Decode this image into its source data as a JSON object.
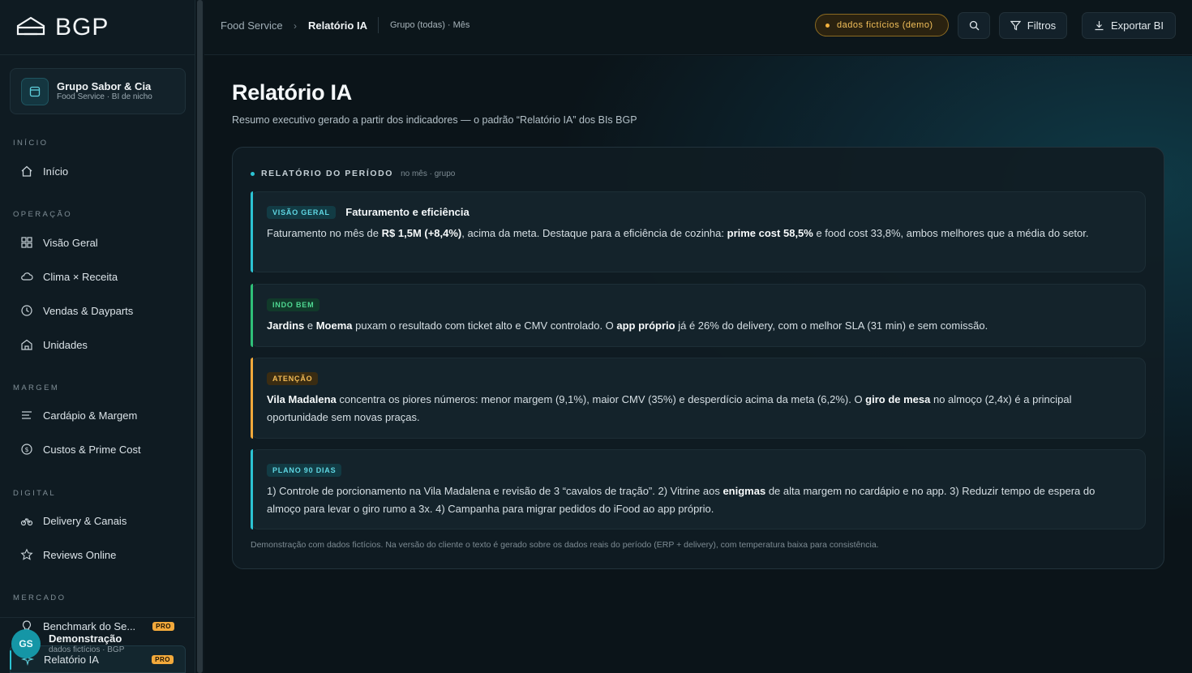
{
  "brand": {
    "logo_text": "BGP"
  },
  "org": {
    "name": "Grupo Sabor & Cia",
    "subtitle": "Food Service · BI de nicho"
  },
  "sidebar": {
    "sections": [
      {
        "label": "INÍCIO",
        "items": [
          {
            "label": "Início",
            "icon": "home-icon"
          }
        ]
      },
      {
        "label": "OPERAÇÃO",
        "items": [
          {
            "label": "Visão Geral",
            "icon": "grid-icon"
          },
          {
            "label": "Clima × Receita",
            "icon": "cloud-icon"
          },
          {
            "label": "Vendas & Dayparts",
            "icon": "clock-icon"
          },
          {
            "label": "Unidades",
            "icon": "store-icon"
          }
        ]
      },
      {
        "label": "MARGEM",
        "items": [
          {
            "label": "Cardápio & Margem",
            "icon": "menu-list-icon"
          },
          {
            "label": "Custos & Prime Cost",
            "icon": "coin-icon"
          }
        ]
      },
      {
        "label": "DIGITAL",
        "items": [
          {
            "label": "Delivery & Canais",
            "icon": "bike-icon"
          },
          {
            "label": "Reviews Online",
            "icon": "star-icon"
          }
        ]
      },
      {
        "label": "MERCADO",
        "items": [
          {
            "label": "Benchmark do Se...",
            "icon": "bulb-icon",
            "badge": "PRO"
          },
          {
            "label": "Relatório IA",
            "icon": "sparkle-icon",
            "badge": "PRO",
            "active": true
          }
        ]
      }
    ]
  },
  "user": {
    "initials": "GS",
    "name": "Demonstração",
    "subtitle": "dados fictícios · BGP"
  },
  "topbar": {
    "breadcrumb": [
      "Food Service",
      "Relatório IA"
    ],
    "separator": "›",
    "context": "Grupo (todas) · Mês",
    "demo_badge": "dados fictícios (demo)",
    "filters_label": "Filtros",
    "export_label": "Exportar BI"
  },
  "page": {
    "title": "Relatório IA",
    "subtitle": "Resumo executivo gerado a partir dos indicadores — o padrão “Relatório IA” dos BIs BGP"
  },
  "report": {
    "title": "RELATÓRIO DO PERÍODO",
    "context": "no mês · grupo",
    "blocks": [
      {
        "tag": "VISÃO GERAL",
        "title": "Faturamento e eficiência",
        "color": "#2cc3d3",
        "parts": [
          [
            "Faturamento no mês de ",
            false
          ],
          [
            "R$ 1,5M (+8,4%)",
            true
          ],
          [
            ", acima da meta. Destaque para a eficiência de cozinha: ",
            false
          ],
          [
            "prime cost 58,5%",
            true
          ],
          [
            " e food cost 33,8%, ambos melhores que a média do setor.",
            false
          ]
        ]
      },
      {
        "tag": "INDO BEM",
        "title": "",
        "color": "#2fbf78",
        "parts": [
          [
            "Jardins",
            true
          ],
          [
            " e ",
            false
          ],
          [
            "Moema",
            true
          ],
          [
            " puxam o resultado com ticket alto e CMV controlado. O ",
            false
          ],
          [
            "app próprio",
            true
          ],
          [
            " já é 26% do delivery, com o melhor SLA (31 min) e sem comissão.",
            false
          ]
        ]
      },
      {
        "tag": "ATENÇÃO",
        "title": "",
        "color": "#f2a93b",
        "parts": [
          [
            "Vila Madalena",
            true
          ],
          [
            " concentra os piores números: menor margem (9,1%), maior CMV (35%) e desperdício acima da meta (6,2%). O ",
            false
          ],
          [
            "giro de mesa",
            true
          ],
          [
            " no almoço (2,4x) é a principal oportunidade sem novas praças.",
            false
          ]
        ]
      },
      {
        "tag": "PLANO 90 DIAS",
        "title": "",
        "color": "#2cc3d3",
        "parts": [
          [
            "1) Controle de porcionamento na Vila Madalena e revisão de 3 “cavalos de tração”. 2) Vitrine aos ",
            false
          ],
          [
            "enigmas",
            true
          ],
          [
            " de alta margem no cardápio e no app. 3) Reduzir tempo de espera do almoço para levar o giro rumo a 3x. 4) Campanha para migrar pedidos do iFood ao app próprio.",
            false
          ]
        ]
      }
    ],
    "footnote": "Demonstração com dados fictícios. Na versão do cliente o texto é gerado sobre os dados reais do período (ERP + delivery), com temperatura baixa para consistência."
  },
  "colors": {
    "accent": "#2cc3d3",
    "good": "#2fbf78",
    "warn": "#f2a93b",
    "background": "#0b1419"
  }
}
